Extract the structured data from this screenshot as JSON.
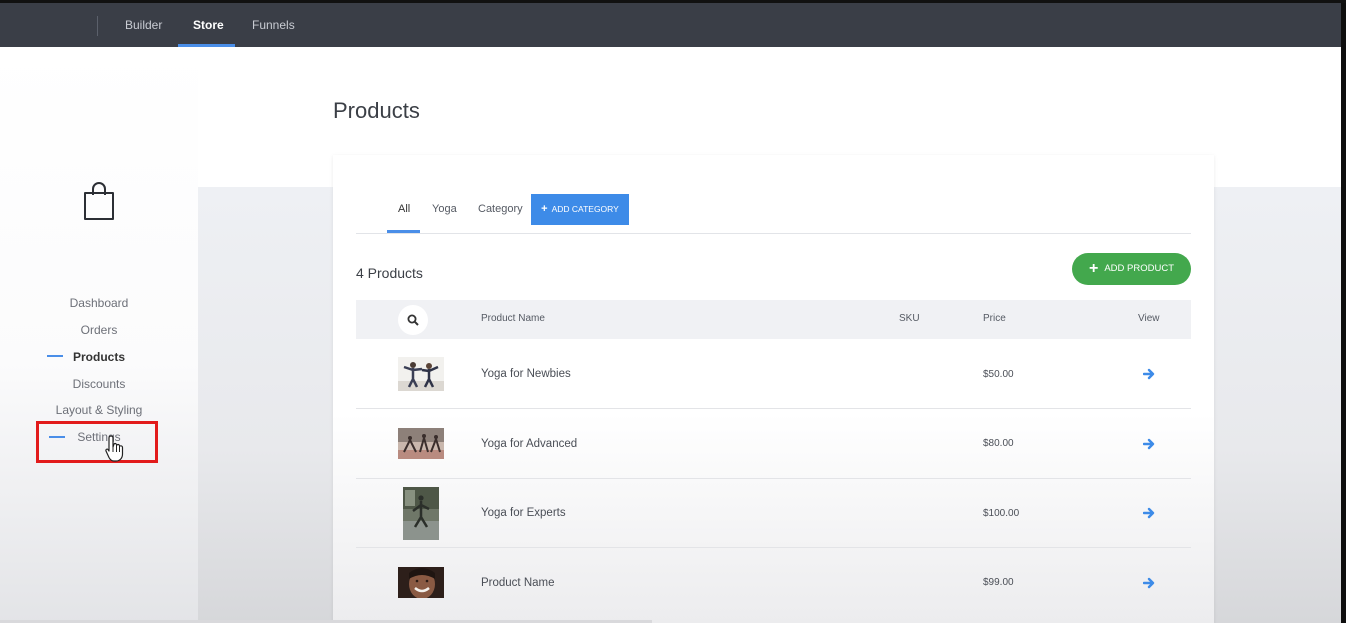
{
  "topnav": {
    "items": [
      {
        "label": "Builder",
        "active": false
      },
      {
        "label": "Store",
        "active": true
      },
      {
        "label": "Funnels",
        "active": false
      }
    ]
  },
  "sidebar": {
    "icon": "shopping-bag-icon",
    "items": [
      {
        "label": "Dashboard",
        "active": false
      },
      {
        "label": "Orders",
        "active": false
      },
      {
        "label": "Products",
        "active": true
      },
      {
        "label": "Discounts",
        "active": false
      },
      {
        "label": "Layout & Styling",
        "active": false
      },
      {
        "label": "Settings",
        "active": false,
        "highlighted": true
      }
    ]
  },
  "main": {
    "title": "Products",
    "tabs": [
      {
        "label": "All",
        "active": true
      },
      {
        "label": "Yoga",
        "active": false
      },
      {
        "label": "Category",
        "active": false
      }
    ],
    "add_category_label": "ADD CATEGORY",
    "count_label": "4 Products",
    "add_product_label": "ADD PRODUCT",
    "table": {
      "headers": {
        "name": "Product Name",
        "sku": "SKU",
        "price": "Price",
        "view": "View"
      },
      "rows": [
        {
          "name": "Yoga for Newbies",
          "sku": "",
          "price": "$50.00",
          "thumb": "yoga-pose-photo"
        },
        {
          "name": "Yoga for Advanced",
          "sku": "",
          "price": "$80.00",
          "thumb": "yoga-class-photo"
        },
        {
          "name": "Yoga for Experts",
          "sku": "",
          "price": "$100.00",
          "thumb": "yoga-studio-photo"
        },
        {
          "name": "Product Name",
          "sku": "",
          "price": "$99.00",
          "thumb": "smiling-woman-photo"
        }
      ]
    }
  },
  "colors": {
    "topbar": "#3a3e47",
    "accent_blue": "#3d8be8",
    "accent_green": "#43a84d",
    "highlight_red": "#e21b1b"
  }
}
